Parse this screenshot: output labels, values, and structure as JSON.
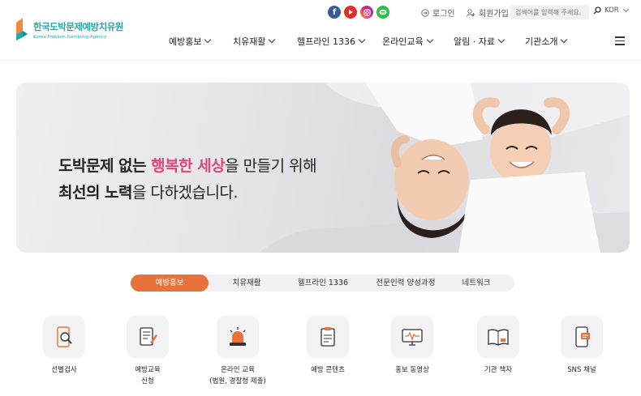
{
  "brand": {
    "name_ko": "한국도박문제예방치유원",
    "name_en": "Korea Problem Gambling Agency",
    "colors": {
      "teal": "#2aa5a8",
      "orange": "#e8723a",
      "pink": "#e0467c"
    }
  },
  "utility": {
    "social": [
      {
        "name": "facebook-icon",
        "color": "#3b5998"
      },
      {
        "name": "youtube-icon",
        "color": "#e52d27"
      },
      {
        "name": "instagram-icon",
        "color": "#c13584"
      },
      {
        "name": "talk-icon",
        "color": "#2dbd4e"
      }
    ],
    "login": "로그인",
    "signup": "회원가입",
    "search_placeholder": "검색어를 입력해 주세요.",
    "language": "KOR"
  },
  "nav": [
    "예방홍보",
    "치유재활",
    "헬프라인 1336",
    "온라인교육",
    "알림 · 자료",
    "기관소개"
  ],
  "hero": {
    "line1_pre": "도박문제 없는 ",
    "line1_highlight": "행복한 세상",
    "line1_post": "을 만들기 위해",
    "line2_bold": "최선의 노력",
    "line2_post": "을 다하겠습니다."
  },
  "tabs": [
    {
      "label": "예방홍보",
      "active": true
    },
    {
      "label": "치유재활"
    },
    {
      "label": "헬프라인 1336"
    },
    {
      "label": "전문인력 양성과정"
    },
    {
      "label": "네트워크"
    }
  ],
  "services": [
    {
      "label": "선별검사",
      "icon": "phone-search-icon"
    },
    {
      "label": "예방교육",
      "label2": "신청",
      "icon": "document-pen-icon"
    },
    {
      "label": "온라인 교육",
      "label2": "(법원, 경찰청 제출)",
      "icon": "alarm-light-icon"
    },
    {
      "label": "예방 콘텐츠",
      "icon": "clipboard-icon"
    },
    {
      "label": "홍보 동영상",
      "icon": "monitor-icon"
    },
    {
      "label": "기관 책자",
      "icon": "book-icon"
    },
    {
      "label": "SNS 채널",
      "icon": "mobile-sns-icon"
    }
  ]
}
